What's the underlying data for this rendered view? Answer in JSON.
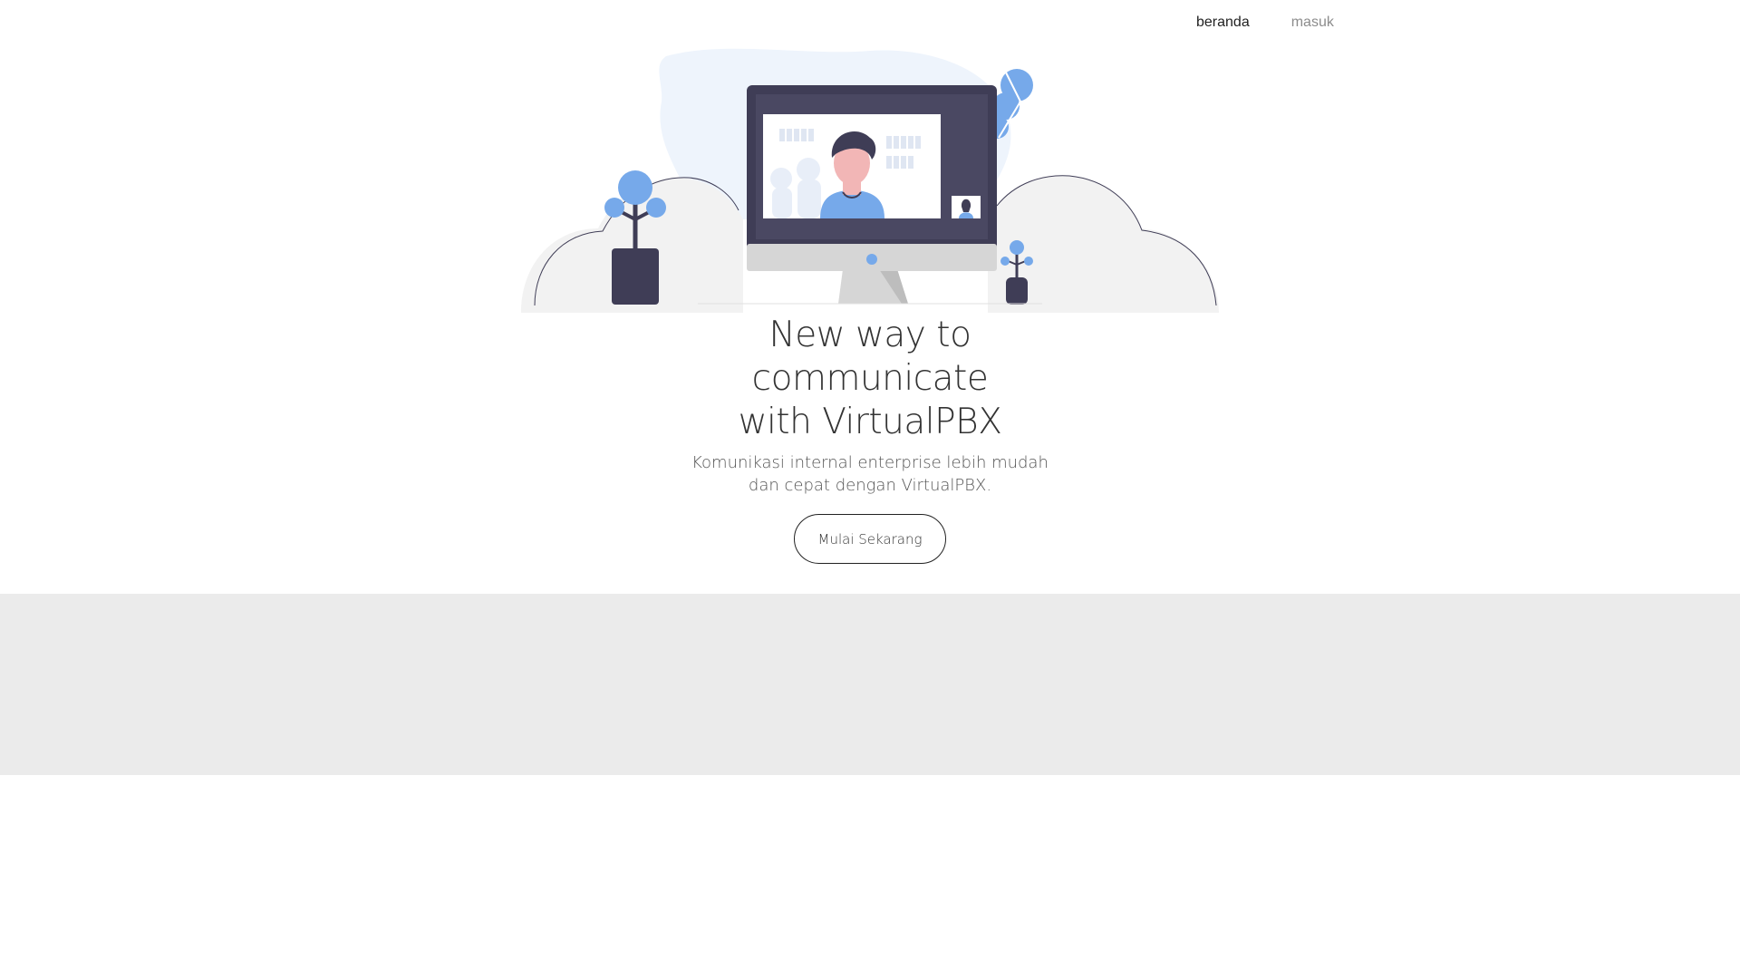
{
  "nav": {
    "items": [
      {
        "label": "beranda",
        "state": "active"
      },
      {
        "label": "masuk",
        "state": "muted"
      }
    ]
  },
  "hero": {
    "title_lines": [
      "New way to",
      "communicate",
      "with VirtualPBX"
    ],
    "subtitle_lines": [
      "Komunikasi internal enterprise lebih mudah",
      "dan cepat dengan VirtualPBX."
    ],
    "cta_label": "Mulai Sekarang",
    "illustration": "video-call-monitor-illustration"
  },
  "colors": {
    "accent_blue": "#76a9ea",
    "dark_navy": "#3f3d56",
    "cloud_grey": "#f2f2f2",
    "band_grey": "#ebebeb",
    "text_dark": "#333333"
  }
}
